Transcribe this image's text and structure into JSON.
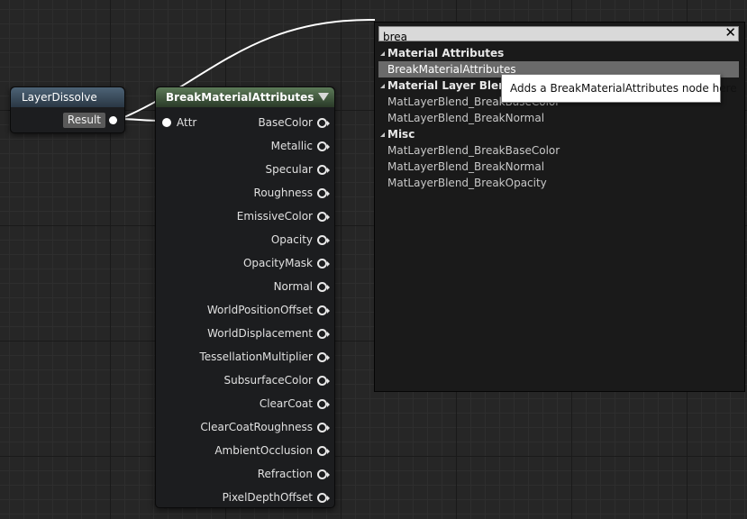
{
  "layer_dissolve_node": {
    "title": "LayerDissolve",
    "output_label": "Result"
  },
  "break_node": {
    "title": "BreakMaterialAttributes",
    "input_label": "Attr",
    "outputs": [
      "BaseColor",
      "Metallic",
      "Specular",
      "Roughness",
      "EmissiveColor",
      "Opacity",
      "OpacityMask",
      "Normal",
      "WorldPositionOffset",
      "WorldDisplacement",
      "TessellationMultiplier",
      "SubsurfaceColor",
      "ClearCoat",
      "ClearCoatRoughness",
      "AmbientOcclusion",
      "Refraction",
      "PixelDepthOffset"
    ]
  },
  "menu": {
    "search_value": "brea",
    "close_glyph": "✕",
    "categories": [
      {
        "name": "Material Attributes",
        "items": [
          "BreakMaterialAttributes"
        ]
      },
      {
        "name": "Material Layer Blend",
        "items": [
          "MatLayerBlend_BreakBaseColor",
          "MatLayerBlend_BreakNormal"
        ]
      },
      {
        "name": "Misc",
        "items": [
          "MatLayerBlend_BreakBaseColor",
          "MatLayerBlend_BreakNormal",
          "MatLayerBlend_BreakOpacity"
        ]
      }
    ],
    "tooltip": "Adds a BreakMaterialAttributes node here"
  },
  "colors": {
    "grid_background": "#262626",
    "node_body": "#1c1d1f",
    "ld_header": "#3b4f60",
    "bma_header": "#4a6246",
    "wire": "#ffffff",
    "selected_item": "#6a6a6a"
  }
}
